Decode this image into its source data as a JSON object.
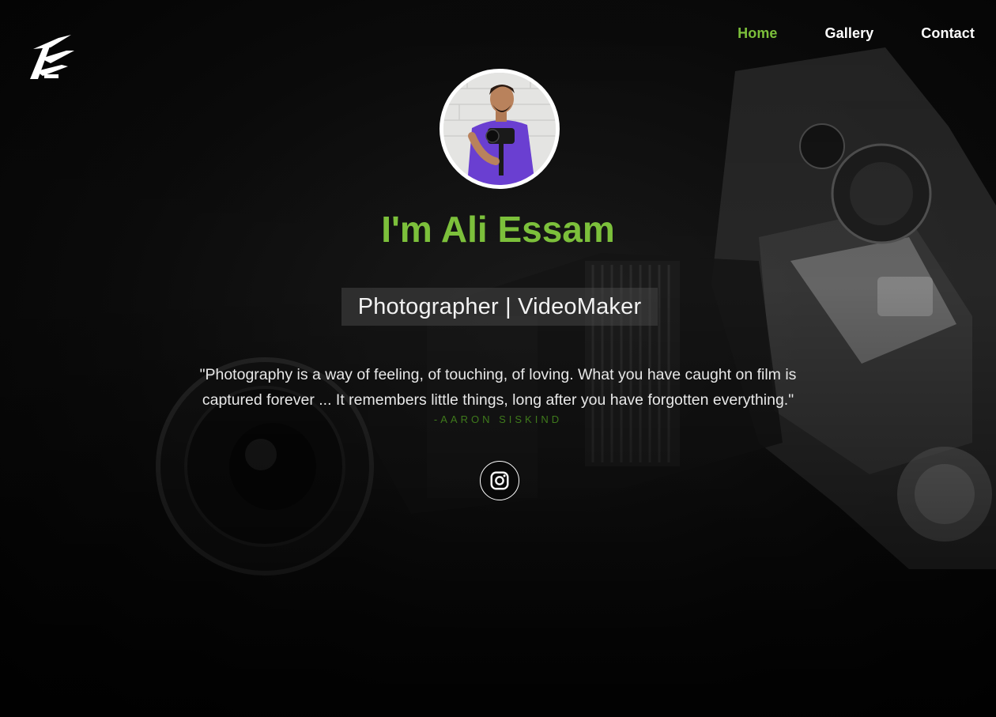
{
  "nav": {
    "items": [
      {
        "label": "Home",
        "active": true
      },
      {
        "label": "Gallery",
        "active": false
      },
      {
        "label": "Contact",
        "active": false
      }
    ]
  },
  "hero": {
    "title": "I'm Ali Essam",
    "role": "Photographer | VideoMaker",
    "quote_line1": "\"Photography is a way of feeling, of touching, of loving. What you have caught on film is",
    "quote_line2": "captured forever ... It remembers little things, long after you have forgotten everything.\"",
    "quote_author": "-AARON SISKIND"
  },
  "social": {
    "icon": "instagram-icon"
  },
  "colors": {
    "accent": "#7cc03b",
    "author": "#3f7a1c",
    "background": "#050505",
    "text": "#ffffff"
  }
}
